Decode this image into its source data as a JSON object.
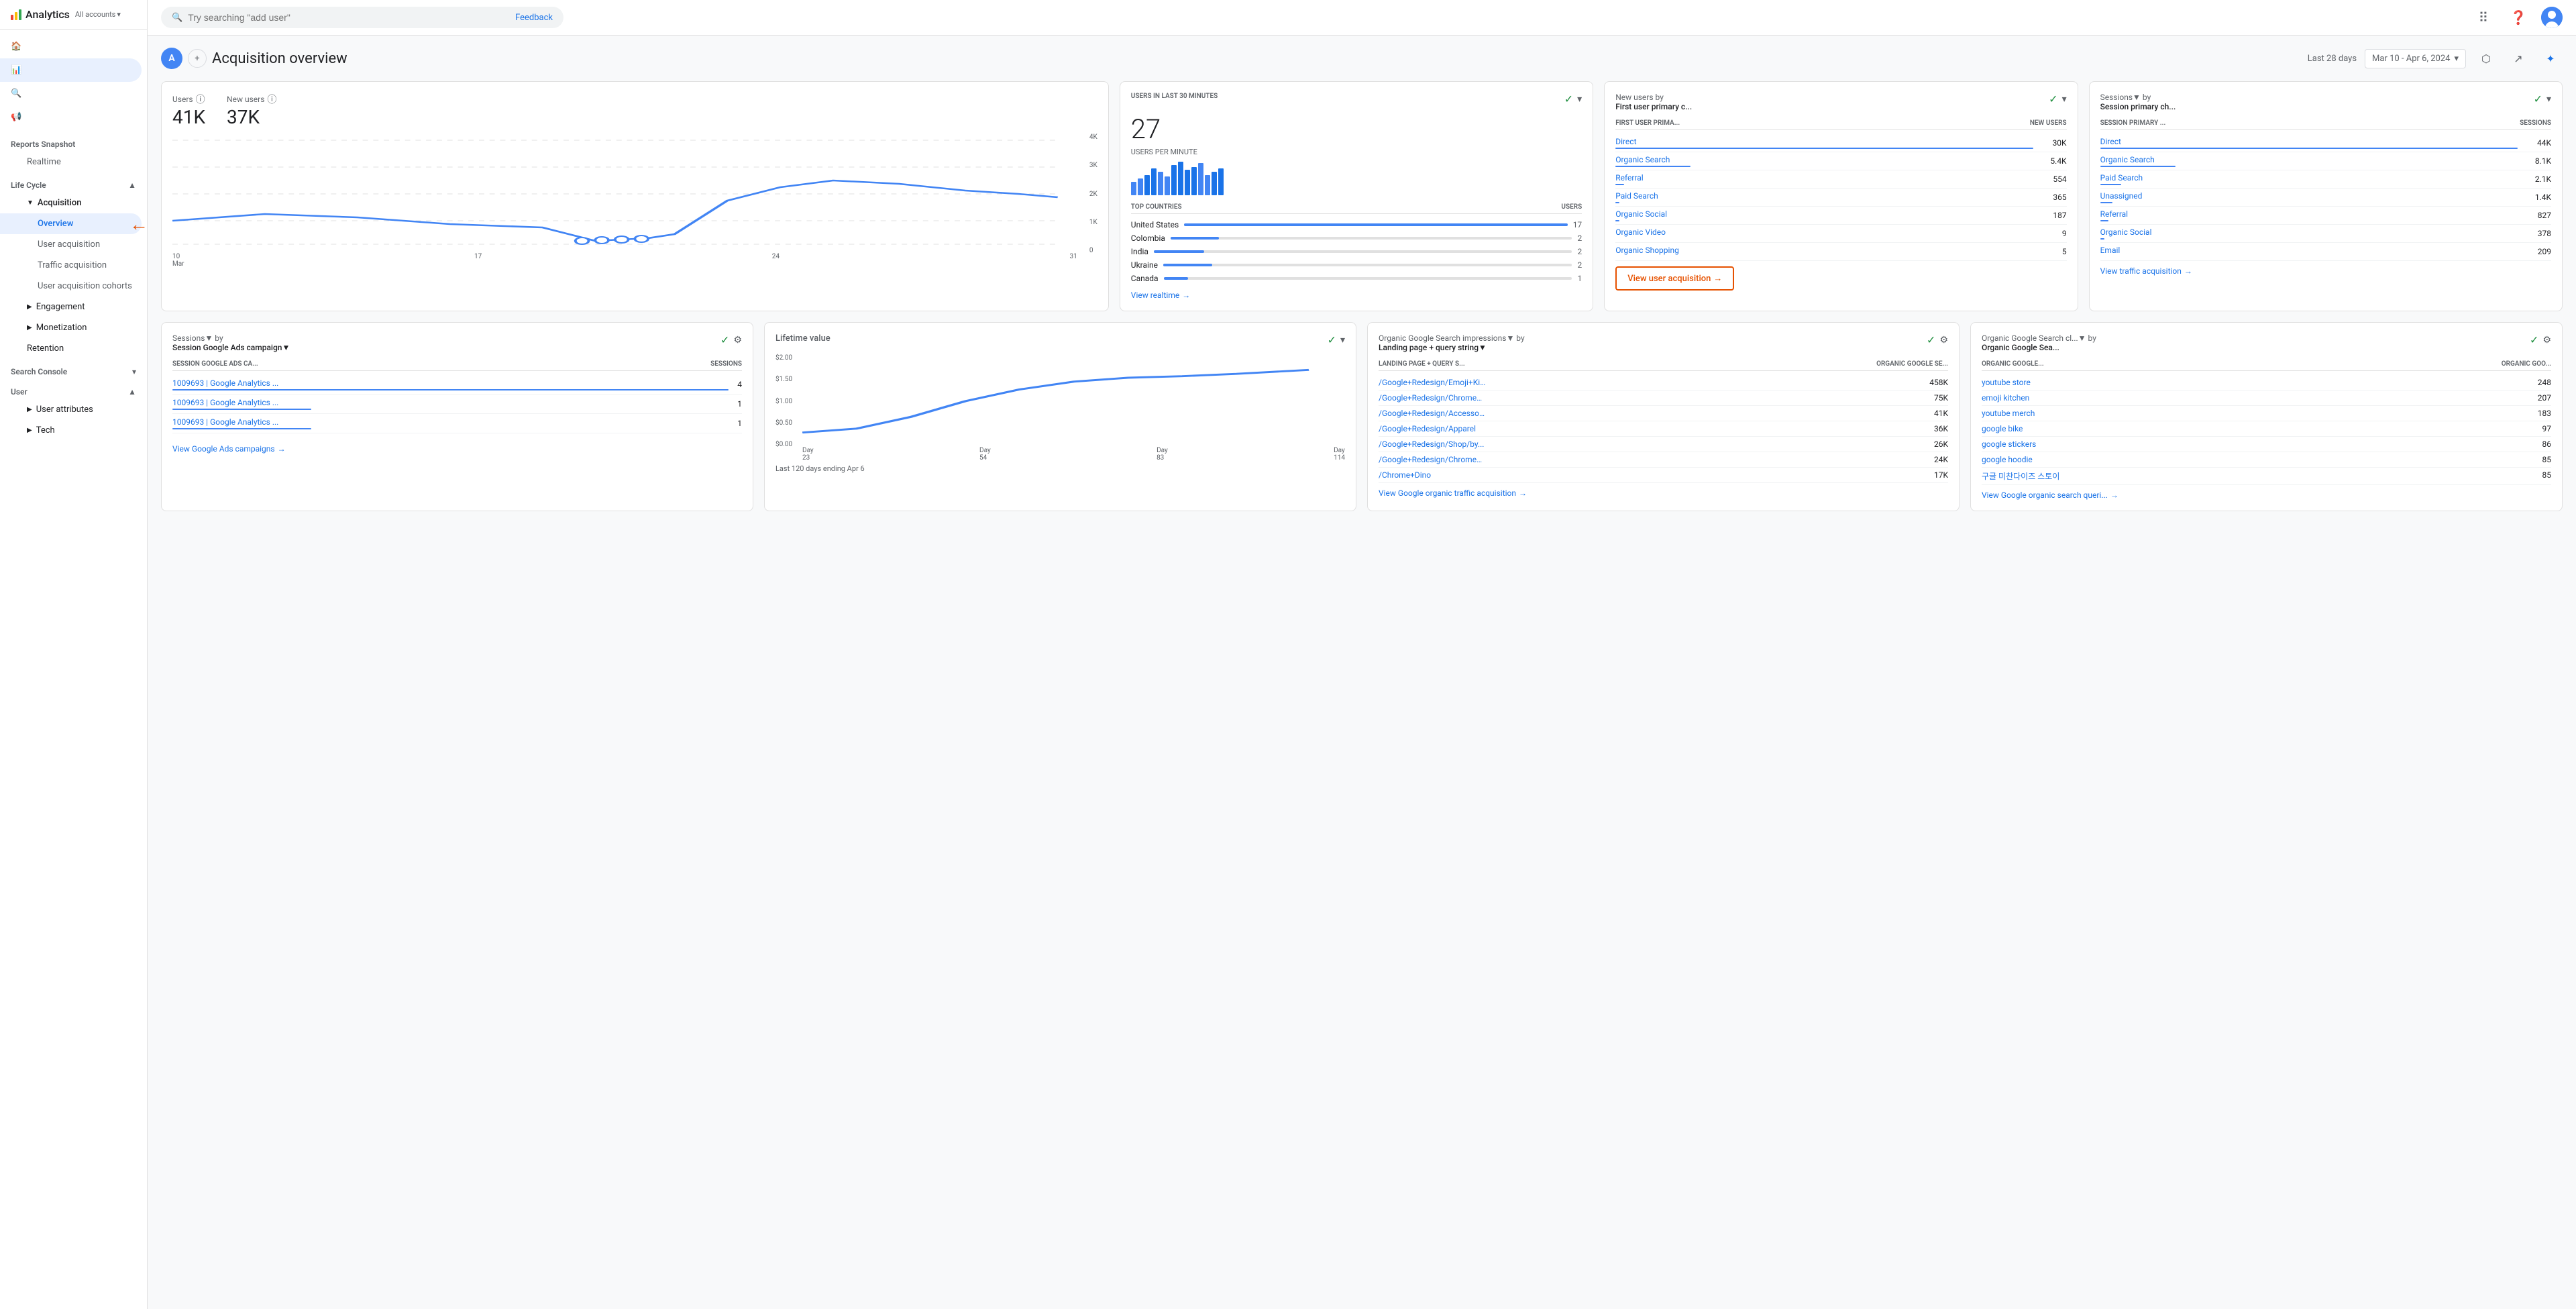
{
  "app": {
    "title": "Analytics",
    "all_accounts": "All accounts"
  },
  "logo": {
    "bars": [
      {
        "height": 8,
        "color": "#EA4335"
      },
      {
        "height": 12,
        "color": "#FBBC04"
      },
      {
        "height": 16,
        "color": "#34A853"
      }
    ]
  },
  "search": {
    "placeholder": "Try searching \"add user\"",
    "feedback_label": "Feedback"
  },
  "sidebar": {
    "nav_icons": [
      {
        "name": "home-icon",
        "symbol": "🏠",
        "label": "Home"
      },
      {
        "name": "reports-icon",
        "symbol": "📊",
        "label": "Reports"
      },
      {
        "name": "explore-icon",
        "symbol": "🔍",
        "label": "Explore"
      },
      {
        "name": "advertising-icon",
        "symbol": "📣",
        "label": "Advertising"
      }
    ],
    "sections": [
      {
        "name": "Reports snapshot",
        "items": [
          {
            "label": "Realtime",
            "active": false,
            "deep": false
          }
        ]
      },
      {
        "name": "Life cycle",
        "collapsed": false,
        "items": [
          {
            "label": "Acquisition",
            "expanded": true,
            "children": [
              {
                "label": "Overview",
                "active": true
              },
              {
                "label": "User acquisition",
                "active": false
              },
              {
                "label": "Traffic acquisition",
                "active": false
              },
              {
                "label": "User acquisition cohorts",
                "active": false
              }
            ]
          },
          {
            "label": "Engagement",
            "expanded": false
          },
          {
            "label": "Monetization",
            "expanded": false
          },
          {
            "label": "Retention",
            "expanded": false
          }
        ]
      },
      {
        "name": "Search Console",
        "collapsed": true,
        "items": []
      },
      {
        "name": "User",
        "collapsed": false,
        "items": [
          {
            "label": "User attributes",
            "expanded": false
          },
          {
            "label": "Tech",
            "expanded": false
          }
        ]
      }
    ]
  },
  "page_header": {
    "project_initial": "A",
    "title": "Acquisition overview",
    "date_label": "Last 28 days",
    "date_range": "Mar 10 - Apr 6, 2024"
  },
  "users_card": {
    "metrics": [
      {
        "label": "Users",
        "value": "41K"
      },
      {
        "label": "New users",
        "value": "37K"
      }
    ],
    "chart": {
      "x_labels": [
        "10\nMar",
        "17",
        "24",
        "31"
      ],
      "y_labels": [
        "4K",
        "3K",
        "2K",
        "1K",
        "0"
      ]
    }
  },
  "realtime_card": {
    "title": "USERS IN LAST 30 MINUTES",
    "value": "27",
    "sub_label": "USERS PER MINUTE",
    "bar_heights": [
      20,
      25,
      30,
      40,
      35,
      28,
      45,
      50,
      38,
      42,
      48,
      30,
      35,
      40,
      45,
      38,
      42,
      50,
      45,
      40
    ],
    "countries_header": [
      "TOP COUNTRIES",
      "USERS"
    ],
    "countries": [
      {
        "name": "United States",
        "users": 17,
        "pct": 100
      },
      {
        "name": "Colombia",
        "users": 2,
        "pct": 12
      },
      {
        "name": "India",
        "users": 2,
        "pct": 12
      },
      {
        "name": "Ukraine",
        "users": 2,
        "pct": 12
      },
      {
        "name": "Canada",
        "users": 1,
        "pct": 6
      }
    ],
    "view_link": "View realtime"
  },
  "new_users_card": {
    "title": "New users by",
    "subtitle": "First user primary c...",
    "headers": [
      "FIRST USER PRIMA...",
      "NEW USERS"
    ],
    "rows": [
      {
        "label": "Direct",
        "value": "30K",
        "bar_pct": 100
      },
      {
        "label": "Organic Search",
        "value": "5.4K",
        "bar_pct": 18
      },
      {
        "label": "Referral",
        "value": "554",
        "bar_pct": 2
      },
      {
        "label": "Paid Search",
        "value": "365",
        "bar_pct": 1
      },
      {
        "label": "Organic Social",
        "value": "187",
        "bar_pct": 1
      },
      {
        "label": "Organic Video",
        "value": "9",
        "bar_pct": 0
      },
      {
        "label": "Organic Shopping",
        "value": "5",
        "bar_pct": 0
      }
    ],
    "view_link": "View user acquisition"
  },
  "sessions_card": {
    "title": "Sessions▼ by",
    "subtitle": "Session primary ch...",
    "headers": [
      "SESSION PRIMARY ...",
      "SESSIONS"
    ],
    "rows": [
      {
        "label": "Direct",
        "value": "44K",
        "bar_pct": 100
      },
      {
        "label": "Organic Search",
        "value": "8.1K",
        "bar_pct": 18
      },
      {
        "label": "Paid Search",
        "value": "2.1K",
        "bar_pct": 5
      },
      {
        "label": "Unassigned",
        "value": "1.4K",
        "bar_pct": 3
      },
      {
        "label": "Referral",
        "value": "827",
        "bar_pct": 2
      },
      {
        "label": "Organic Social",
        "value": "378",
        "bar_pct": 1
      },
      {
        "label": "Email",
        "value": "209",
        "bar_pct": 0
      }
    ],
    "view_link": "View traffic acquisition"
  },
  "google_ads_card": {
    "title": "Sessions▼ by",
    "subtitle": "Session Google Ads campaign▼",
    "headers": [
      "SESSION GOOGLE ADS CA...",
      "SESSIONS"
    ],
    "rows": [
      {
        "label": "1009693 | Google Analytics ...",
        "value": "4",
        "bar_pct": 100
      },
      {
        "label": "1009693 | Google Analytics ...",
        "value": "1",
        "bar_pct": 25
      },
      {
        "label": "1009693 | Google Analytics ...",
        "value": "1",
        "bar_pct": 25
      }
    ],
    "view_link": "View Google Ads campaigns"
  },
  "lifetime_value_card": {
    "title": "Lifetime value",
    "y_labels": [
      "$2.00",
      "$1.50",
      "$1.00",
      "$0.50",
      "$0.00"
    ],
    "x_labels": [
      "Day\n23",
      "Day\n54",
      "Day\n83",
      "Day\n114"
    ],
    "footer": "Last 120 days ending Apr 6"
  },
  "organic_impressions_card": {
    "title": "Organic Google Search impressions▼ by",
    "subtitle": "Landing page + query string▼",
    "headers": [
      "LANDING PAGE + QUERY S...",
      "ORGANIC GOOGLE SE..."
    ],
    "rows": [
      {
        "label": "/Google+Redesign/Emoji+Ki...",
        "value": "458K"
      },
      {
        "label": "/Google+Redesign/Chrome+...",
        "value": "75K"
      },
      {
        "label": "/Google+Redesign/Accessor...",
        "value": "41K"
      },
      {
        "label": "/Google+Redesign/Apparel",
        "value": "36K"
      },
      {
        "label": "/Google+Redesign/Shop/by...",
        "value": "26K"
      },
      {
        "label": "/Google+Redesign/Chrome+...",
        "value": "24K"
      },
      {
        "label": "/Chrome+Dino",
        "value": "17K"
      }
    ],
    "view_link": "View Google organic traffic acquisition"
  },
  "organic_clicks_card": {
    "title": "Organic Google Search cl...▼ by",
    "subtitle": "Organic Google Sea...",
    "headers": [
      "ORGANIC GOOGLE...",
      "ORGANIC GOO..."
    ],
    "rows": [
      {
        "label": "youtube store",
        "value": "248"
      },
      {
        "label": "emoji kitchen",
        "value": "207"
      },
      {
        "label": "youtube merch",
        "value": "183"
      },
      {
        "label": "google bike",
        "value": "97"
      },
      {
        "label": "google stickers",
        "value": "86"
      },
      {
        "label": "google hoodie",
        "value": "85"
      },
      {
        "label": "구글 미찬다이즈 스토이",
        "value": "85"
      }
    ],
    "view_link": "View Google organic search queri..."
  },
  "colors": {
    "accent": "#1a73e8",
    "highlight": "#e65100",
    "chart_line": "#4285f4",
    "positive": "#1e8e3e"
  }
}
